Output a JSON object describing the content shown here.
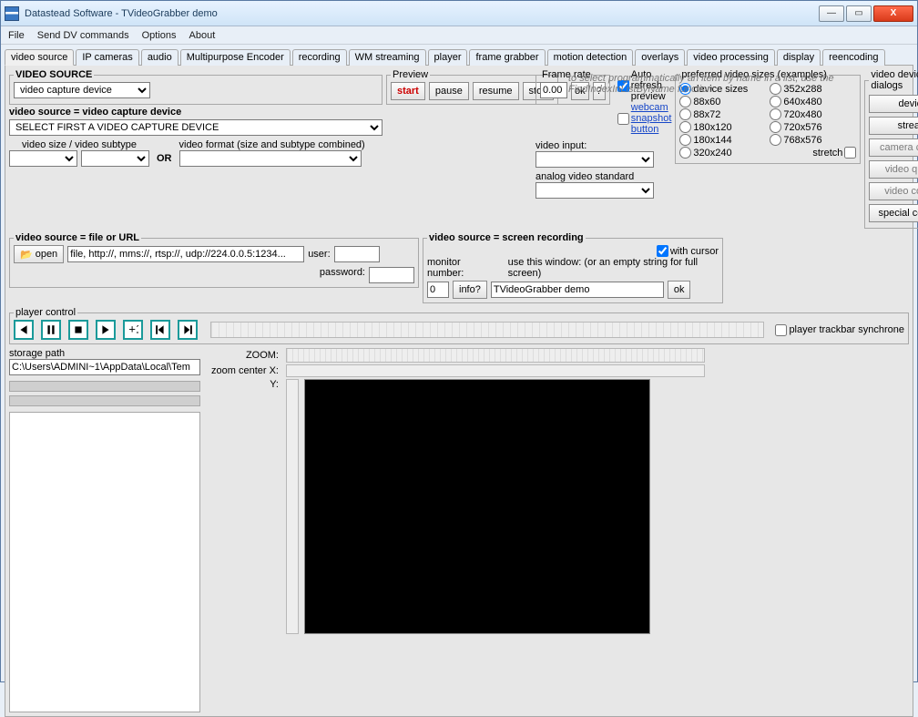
{
  "window": {
    "title": "Datastead Software - TVideoGrabber demo"
  },
  "menu": {
    "file": "File",
    "senddv": "Send DV commands",
    "options": "Options",
    "about": "About"
  },
  "tabs": [
    "video source",
    "IP cameras",
    "audio",
    "Multipurpose Encoder",
    "recording",
    "WM streaming",
    "player",
    "frame grabber",
    "motion detection",
    "overlays",
    "video processing",
    "display",
    "reencoding"
  ],
  "vs": {
    "legend": "VIDEO SOURCE",
    "combo": "video capture device",
    "subhdr": "video source = video capture device",
    "devcombo": "SELECT FIRST A VIDEO CAPTURE DEVICE",
    "sizesub": "video size / video subtype",
    "or": "OR",
    "fmt": "video format (size and subtype combined)",
    "vinput": "video input:",
    "analog": "analog video standard"
  },
  "preview": {
    "legend": "Preview",
    "start": "start",
    "pause": "pause",
    "resume": "resume",
    "stop": "stop"
  },
  "framerate": {
    "legend": "Frame rate",
    "value": "0.00",
    "ok": "ok",
    "run": "?"
  },
  "auto": "Auto refresh preview",
  "snapshot": "webcam snapshot button",
  "hint": "to select programmatically an item by name in a list, use the FindIndexInListByName function",
  "pvs": {
    "legend": "preferred video sizes (examples)",
    "left": [
      "device sizes",
      "88x60",
      "88x72",
      "180x120",
      "180x144",
      "320x240"
    ],
    "right": [
      "352x288",
      "640x480",
      "720x480",
      "720x576",
      "768x576"
    ],
    "stretch": "stretch"
  },
  "dialogs": {
    "legend": "video device dialogs",
    "device": "device",
    "stream": "stream",
    "camera": "camera control",
    "quality": "video quality",
    "vctrl": "video control",
    "special": "special controls"
  },
  "fileurl": {
    "legend": "video source = file or URL",
    "open": "open",
    "text": "file, http://, mms://, rtsp://, udp://224.0.0.5:1234...",
    "user": "user:",
    "password": "password:"
  },
  "screen": {
    "legend": "video source = screen recording",
    "withcursor": "with cursor",
    "monitor": "monitor number:",
    "monval": "0",
    "info": "info?",
    "usewin": "use this window: (or an empty string for full screen)",
    "winval": "TVideoGrabber demo",
    "ok": "ok"
  },
  "player": {
    "legend": "player control",
    "sync": "player trackbar synchrone"
  },
  "storage": {
    "legend": "storage path",
    "value": "C:\\Users\\ADMINI~1\\AppData\\Local\\Tem"
  },
  "zoom": {
    "label": "ZOOM:",
    "cx": "zoom center X:",
    "cy": "Y:"
  }
}
